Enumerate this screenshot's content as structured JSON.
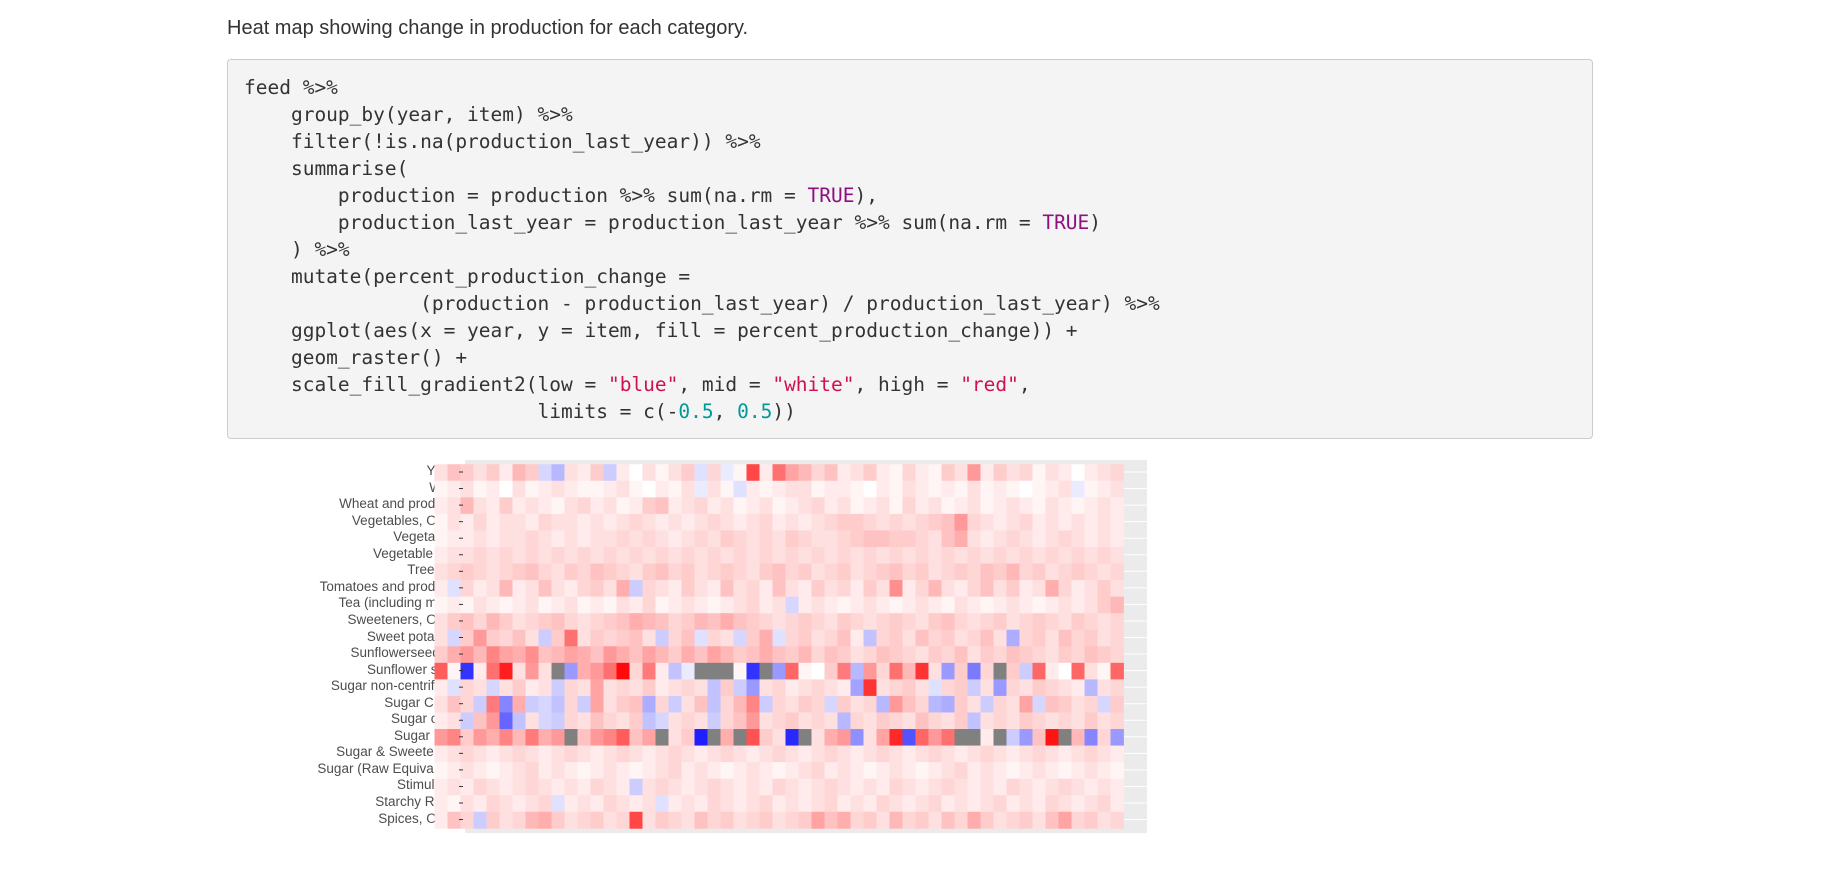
{
  "caption": "Heat map showing change in production for each category.",
  "code": {
    "lines": [
      [
        [
          "feed %>%",
          ""
        ]
      ],
      [
        [
          "    group_by(year, item) %>%",
          ""
        ]
      ],
      [
        [
          "    filter(!is.na(production_last_year)) %>%",
          ""
        ]
      ],
      [
        [
          "    summarise(",
          ""
        ]
      ],
      [
        [
          "        production = production %>% sum(na.rm = ",
          ""
        ],
        [
          "TRUE",
          "kw"
        ],
        [
          "),",
          ""
        ]
      ],
      [
        [
          "        production_last_year = production_last_year %>% sum(na.rm = ",
          ""
        ],
        [
          "TRUE",
          "kw"
        ],
        [
          ")",
          ""
        ]
      ],
      [
        [
          "    ) %>%",
          ""
        ]
      ],
      [
        [
          "    mutate(percent_production_change =",
          ""
        ]
      ],
      [
        [
          "               (production - production_last_year) / production_last_year) %>%",
          ""
        ]
      ],
      [
        [
          "    ggplot(aes(x = year, y = item, fill = percent_production_change)) +",
          ""
        ]
      ],
      [
        [
          "    geom_raster() +",
          ""
        ]
      ],
      [
        [
          "    scale_fill_gradient2(low = ",
          ""
        ],
        [
          "\"blue\"",
          "str"
        ],
        [
          ", mid = ",
          ""
        ],
        [
          "\"white\"",
          "str"
        ],
        [
          ", high = ",
          ""
        ],
        [
          "\"red\"",
          "str"
        ],
        [
          ",",
          ""
        ]
      ],
      [
        [
          "                         limits = c(-",
          ""
        ],
        [
          "0.5",
          "num"
        ],
        [
          ", ",
          ""
        ],
        [
          "0.5",
          "num"
        ],
        [
          "))",
          ""
        ]
      ]
    ]
  },
  "chart_data": {
    "type": "heatmap",
    "x_var": "year",
    "y_var": "item",
    "fill_var": "percent_production_change",
    "fill_scale": {
      "low": "#0000ff",
      "mid": "#ffffff",
      "high": "#ff0000",
      "limits": [
        -0.5,
        0.5
      ],
      "na_color": "#808080"
    },
    "panel_background": "#ebebeb",
    "grid": true,
    "y_categories": [
      "Yams",
      "Wine",
      "Wheat and products",
      "Vegetables, Other",
      "Vegetables",
      "Vegetable Oils",
      "Treenuts",
      "Tomatoes and products",
      "Tea (including mate)",
      "Sweeteners, Other",
      "Sweet potatoes",
      "Sunflowerseed Oil",
      "Sunflower seed",
      "Sugar non-centrifugal",
      "Sugar Crops",
      "Sugar cane",
      "Sugar beet",
      "Sugar & Sweeteners",
      "Sugar (Raw Equivalent)",
      "Stimulants",
      "Starchy Roots",
      "Spices, Other"
    ],
    "rows": [
      [
        0.06,
        0.12,
        0.1,
        0.06,
        0.1,
        0.04,
        0.14,
        0.1,
        -0.08,
        -0.14,
        0.06,
        0.04,
        0.1,
        -0.1,
        0.04,
        0.0,
        0.06,
        0.02,
        0.06,
        0.1,
        -0.06,
        0.08,
        -0.04,
        0.02,
        0.36,
        0.04,
        0.28,
        0.18,
        0.14,
        0.08,
        0.12,
        0.04,
        0.06,
        0.1,
        0.04,
        0.02,
        0.08,
        0.04,
        0.02,
        0.1,
        0.06,
        0.2,
        0.04,
        0.1,
        0.06,
        0.08,
        0.02,
        0.06,
        0.04,
        0.0,
        0.04,
        0.06,
        0.08
      ],
      [
        0.02,
        0.04,
        0.06,
        0.02,
        0.04,
        0.0,
        0.06,
        0.02,
        0.04,
        0.06,
        0.04,
        0.02,
        0.02,
        0.04,
        0.06,
        0.02,
        0.0,
        0.04,
        0.02,
        0.06,
        -0.04,
        0.06,
        0.02,
        -0.06,
        0.04,
        0.02,
        0.04,
        0.06,
        0.06,
        0.02,
        0.04,
        0.04,
        0.02,
        0.0,
        0.04,
        0.02,
        0.06,
        0.04,
        0.02,
        0.04,
        0.02,
        0.06,
        0.02,
        0.04,
        0.02,
        0.0,
        0.02,
        0.04,
        0.06,
        -0.04,
        0.02,
        0.04,
        0.06
      ],
      [
        0.04,
        0.06,
        0.14,
        0.06,
        0.04,
        0.1,
        0.04,
        0.06,
        0.04,
        0.02,
        0.06,
        0.08,
        0.04,
        0.06,
        0.02,
        0.04,
        0.1,
        0.12,
        0.04,
        0.06,
        0.08,
        0.04,
        0.06,
        0.02,
        0.04,
        0.06,
        0.02,
        0.04,
        0.06,
        0.08,
        0.04,
        0.06,
        0.02,
        0.04,
        0.06,
        0.02,
        0.08,
        0.04,
        0.06,
        0.02,
        0.04,
        0.06,
        0.02,
        0.04,
        0.06,
        0.04,
        0.02,
        0.06,
        0.04,
        0.02,
        0.04,
        0.06,
        0.04
      ],
      [
        0.02,
        0.06,
        0.04,
        0.08,
        0.04,
        0.06,
        0.06,
        0.04,
        0.08,
        0.06,
        0.06,
        0.04,
        0.06,
        0.04,
        0.06,
        0.08,
        0.06,
        0.04,
        0.06,
        0.04,
        0.06,
        0.08,
        0.06,
        0.04,
        0.06,
        0.08,
        0.04,
        0.06,
        0.04,
        0.06,
        0.08,
        0.1,
        0.1,
        0.08,
        0.06,
        0.08,
        0.06,
        0.08,
        0.1,
        0.12,
        0.2,
        0.08,
        0.06,
        0.04,
        0.06,
        0.08,
        0.04,
        0.06,
        0.04,
        0.06,
        0.04,
        0.06,
        0.04
      ],
      [
        0.02,
        0.04,
        0.04,
        0.06,
        0.04,
        0.06,
        0.06,
        0.08,
        0.06,
        0.04,
        0.06,
        0.04,
        0.06,
        0.06,
        0.08,
        0.06,
        0.08,
        0.06,
        0.04,
        0.06,
        0.08,
        0.06,
        0.1,
        0.08,
        0.06,
        0.08,
        0.06,
        0.1,
        0.08,
        0.06,
        0.06,
        0.08,
        0.1,
        0.12,
        0.12,
        0.1,
        0.1,
        0.08,
        0.06,
        0.12,
        0.16,
        0.06,
        0.04,
        0.06,
        0.08,
        0.06,
        0.04,
        0.06,
        0.08,
        0.06,
        0.04,
        0.06,
        0.04
      ],
      [
        0.04,
        0.06,
        0.06,
        0.08,
        0.06,
        0.08,
        0.06,
        0.08,
        0.06,
        0.08,
        0.06,
        0.08,
        0.06,
        0.08,
        0.06,
        0.08,
        0.06,
        0.08,
        0.06,
        0.08,
        0.06,
        0.08,
        0.06,
        0.08,
        0.06,
        0.08,
        0.06,
        0.08,
        0.06,
        0.08,
        0.06,
        0.08,
        0.06,
        0.08,
        0.06,
        0.08,
        0.06,
        0.08,
        0.06,
        0.08,
        0.06,
        0.08,
        0.06,
        0.08,
        0.06,
        0.08,
        0.06,
        0.08,
        0.06,
        0.08,
        0.06,
        0.08,
        0.06
      ],
      [
        0.06,
        0.08,
        0.1,
        0.08,
        0.06,
        0.08,
        0.1,
        0.12,
        0.08,
        0.06,
        0.1,
        0.08,
        0.12,
        0.1,
        0.08,
        0.06,
        0.1,
        0.12,
        0.08,
        0.1,
        0.06,
        0.08,
        0.1,
        0.08,
        0.06,
        0.1,
        0.12,
        0.08,
        0.1,
        0.06,
        0.08,
        0.1,
        0.06,
        0.08,
        0.1,
        0.12,
        0.08,
        0.1,
        0.06,
        0.08,
        0.1,
        0.08,
        0.12,
        0.1,
        0.14,
        0.08,
        0.1,
        0.06,
        0.08,
        0.1,
        0.08,
        0.06,
        0.08
      ],
      [
        0.04,
        -0.06,
        0.08,
        0.04,
        0.06,
        0.14,
        0.04,
        0.06,
        0.12,
        0.06,
        0.04,
        0.08,
        0.1,
        0.06,
        0.16,
        -0.1,
        0.08,
        0.06,
        0.04,
        0.1,
        0.06,
        0.04,
        0.12,
        0.06,
        0.08,
        0.04,
        0.12,
        0.06,
        0.04,
        0.1,
        0.06,
        0.08,
        0.04,
        0.1,
        0.06,
        0.22,
        0.04,
        0.08,
        0.14,
        0.06,
        0.04,
        0.08,
        0.12,
        0.06,
        0.1,
        0.04,
        0.06,
        0.16,
        0.08,
        0.04,
        0.06,
        0.1,
        0.06
      ],
      [
        0.02,
        0.04,
        0.02,
        0.06,
        0.04,
        0.02,
        0.04,
        0.06,
        0.02,
        0.04,
        0.06,
        0.02,
        0.04,
        0.02,
        0.06,
        0.04,
        0.08,
        0.02,
        0.04,
        0.06,
        0.04,
        0.02,
        0.04,
        0.06,
        0.08,
        0.04,
        0.06,
        -0.08,
        0.04,
        0.06,
        0.04,
        0.02,
        0.04,
        0.06,
        0.04,
        0.02,
        0.04,
        0.06,
        0.04,
        0.02,
        0.06,
        0.04,
        0.02,
        0.04,
        0.06,
        0.04,
        0.02,
        0.04,
        0.06,
        0.04,
        0.06,
        0.1,
        0.14
      ],
      [
        0.06,
        0.1,
        0.12,
        0.08,
        0.14,
        0.1,
        0.06,
        0.08,
        0.1,
        0.12,
        0.08,
        0.06,
        0.08,
        0.1,
        0.12,
        0.16,
        0.14,
        0.12,
        0.08,
        0.1,
        0.14,
        0.12,
        0.16,
        0.12,
        0.1,
        0.08,
        0.06,
        0.08,
        0.1,
        0.08,
        0.06,
        0.1,
        0.08,
        0.06,
        0.08,
        0.1,
        0.08,
        0.06,
        0.1,
        0.12,
        0.08,
        0.06,
        0.08,
        0.1,
        0.06,
        0.08,
        0.1,
        0.08,
        0.06,
        0.1,
        0.08,
        0.06,
        0.08
      ],
      [
        0.06,
        -0.08,
        0.1,
        0.2,
        0.1,
        0.08,
        0.12,
        0.06,
        -0.1,
        0.1,
        0.28,
        0.06,
        0.1,
        0.08,
        0.1,
        0.12,
        0.06,
        -0.1,
        0.08,
        0.12,
        -0.06,
        0.08,
        0.06,
        -0.08,
        0.1,
        0.16,
        -0.06,
        0.08,
        0.1,
        0.06,
        0.08,
        0.12,
        0.04,
        -0.12,
        0.08,
        0.1,
        0.06,
        0.12,
        0.08,
        0.1,
        0.06,
        0.08,
        0.12,
        0.06,
        -0.16,
        0.08,
        0.1,
        0.06,
        0.12,
        0.08,
        0.1,
        0.06,
        0.08
      ],
      [
        0.1,
        0.16,
        0.2,
        0.14,
        0.24,
        0.18,
        0.16,
        0.22,
        0.12,
        0.14,
        0.18,
        0.16,
        0.12,
        0.2,
        0.16,
        0.12,
        0.18,
        0.14,
        0.1,
        0.16,
        0.12,
        0.18,
        0.14,
        0.1,
        0.12,
        0.16,
        0.12,
        0.1,
        0.14,
        0.08,
        0.12,
        0.1,
        0.06,
        0.08,
        0.12,
        0.1,
        0.08,
        0.06,
        0.1,
        0.08,
        0.12,
        0.06,
        0.1,
        0.08,
        0.12,
        0.1,
        0.08,
        0.06,
        0.1,
        0.08,
        0.12,
        0.1,
        0.08
      ],
      [
        0.32,
        0.02,
        -0.4,
        0.04,
        0.28,
        0.44,
        0.06,
        0.2,
        0.06,
        null,
        -0.2,
        0.16,
        0.2,
        0.28,
        0.48,
        0.08,
        0.26,
        0.04,
        -0.12,
        -0.04,
        null,
        null,
        null,
        0.02,
        -0.4,
        null,
        -0.2,
        0.3,
        0.02,
        0.0,
        0.1,
        0.26,
        -0.14,
        0.2,
        0.08,
        0.28,
        0.14,
        0.4,
        0.06,
        -0.2,
        0.1,
        -0.26,
        0.08,
        null,
        0.1,
        -0.1,
        0.3,
        0.04,
        0.0,
        0.3,
        0.06,
        0.02,
        0.3
      ],
      [
        0.04,
        -0.06,
        0.08,
        0.06,
        -0.08,
        0.06,
        0.1,
        0.04,
        0.06,
        -0.1,
        0.08,
        0.06,
        0.18,
        0.06,
        0.08,
        0.06,
        0.1,
        0.04,
        0.06,
        0.08,
        0.06,
        -0.12,
        0.1,
        -0.1,
        -0.2,
        0.06,
        0.08,
        0.04,
        0.06,
        0.08,
        0.06,
        0.04,
        -0.18,
        0.4,
        0.06,
        0.08,
        0.1,
        0.06,
        -0.06,
        0.08,
        0.1,
        -0.1,
        0.06,
        -0.2,
        0.08,
        0.06,
        0.1,
        0.08,
        0.06,
        0.04,
        -0.14,
        0.06,
        0.08
      ],
      [
        0.06,
        0.12,
        0.08,
        -0.1,
        0.26,
        -0.24,
        0.16,
        -0.1,
        -0.08,
        -0.12,
        0.08,
        -0.1,
        0.18,
        0.06,
        0.1,
        0.12,
        -0.16,
        0.08,
        -0.1,
        0.06,
        0.12,
        -0.12,
        0.08,
        0.14,
        0.24,
        -0.1,
        0.08,
        0.06,
        0.1,
        0.08,
        -0.08,
        0.1,
        0.06,
        0.08,
        -0.14,
        0.2,
        0.12,
        0.08,
        -0.14,
        -0.16,
        0.1,
        0.06,
        -0.1,
        0.08,
        0.06,
        0.18,
        -0.08,
        0.12,
        0.1,
        0.06,
        0.08,
        -0.08,
        0.1
      ],
      [
        0.04,
        0.06,
        -0.1,
        0.12,
        0.2,
        -0.3,
        -0.12,
        0.06,
        -0.08,
        -0.1,
        0.08,
        0.06,
        0.12,
        0.08,
        0.06,
        0.1,
        -0.12,
        -0.08,
        0.06,
        0.08,
        0.06,
        -0.1,
        0.08,
        0.12,
        0.2,
        0.06,
        0.08,
        0.1,
        0.06,
        0.08,
        0.06,
        -0.14,
        0.08,
        0.06,
        0.1,
        0.08,
        0.06,
        0.12,
        0.08,
        0.06,
        0.1,
        -0.12,
        0.06,
        0.08,
        0.06,
        0.1,
        0.08,
        0.06,
        0.08,
        0.06,
        0.1,
        0.06,
        0.08
      ],
      [
        0.2,
        0.24,
        0.1,
        0.2,
        0.16,
        0.24,
        0.14,
        0.26,
        0.16,
        0.2,
        null,
        0.12,
        0.2,
        0.24,
        0.32,
        0.12,
        0.18,
        null,
        0.06,
        0.1,
        -0.44,
        null,
        0.16,
        null,
        0.34,
        0.1,
        0.06,
        -0.42,
        null,
        0.06,
        0.16,
        0.2,
        -0.22,
        0.06,
        0.18,
        0.42,
        -0.34,
        0.3,
        0.2,
        0.28,
        null,
        null,
        0.04,
        null,
        -0.1,
        -0.2,
        0.12,
        0.46,
        null,
        0.14,
        -0.24,
        0.08,
        -0.2
      ],
      [
        0.04,
        0.06,
        0.08,
        0.06,
        0.04,
        0.06,
        0.08,
        0.06,
        0.04,
        0.06,
        0.08,
        0.06,
        0.04,
        0.06,
        0.08,
        0.06,
        0.04,
        0.06,
        0.08,
        0.06,
        0.04,
        0.06,
        0.08,
        0.06,
        0.04,
        0.06,
        0.08,
        0.06,
        0.04,
        0.06,
        0.08,
        0.06,
        0.04,
        0.06,
        0.08,
        0.06,
        0.04,
        0.06,
        0.08,
        0.06,
        0.04,
        0.06,
        0.08,
        0.06,
        0.04,
        0.06,
        0.08,
        0.06,
        0.04,
        0.06,
        0.08,
        0.06,
        0.04
      ],
      [
        0.02,
        0.04,
        0.06,
        0.04,
        0.02,
        0.04,
        0.06,
        0.08,
        0.04,
        0.06,
        0.04,
        0.02,
        0.04,
        0.06,
        0.04,
        0.02,
        0.04,
        0.06,
        0.08,
        0.04,
        0.06,
        0.04,
        0.02,
        0.04,
        0.06,
        0.04,
        0.02,
        0.04,
        0.06,
        0.08,
        0.04,
        0.06,
        0.04,
        0.02,
        0.04,
        0.06,
        0.04,
        0.02,
        0.04,
        0.06,
        0.08,
        0.04,
        0.06,
        0.04,
        0.02,
        0.04,
        0.06,
        0.04,
        0.02,
        0.04,
        0.06,
        0.04,
        0.02
      ],
      [
        0.04,
        0.06,
        0.04,
        0.08,
        0.06,
        0.04,
        0.06,
        0.08,
        0.06,
        0.04,
        0.06,
        0.04,
        0.08,
        0.06,
        0.04,
        -0.1,
        0.06,
        0.08,
        0.06,
        0.04,
        0.06,
        0.08,
        0.06,
        0.04,
        0.06,
        0.04,
        0.08,
        0.06,
        0.04,
        0.06,
        0.08,
        0.06,
        0.04,
        0.06,
        0.04,
        0.08,
        0.06,
        0.04,
        0.06,
        0.08,
        0.06,
        0.04,
        0.06,
        0.04,
        0.08,
        0.06,
        0.04,
        0.06,
        0.08,
        0.06,
        0.04,
        0.06,
        0.04
      ],
      [
        0.04,
        0.02,
        0.06,
        0.04,
        0.08,
        0.06,
        0.04,
        0.06,
        0.08,
        -0.06,
        0.04,
        0.06,
        0.04,
        0.08,
        0.06,
        0.04,
        0.06,
        -0.06,
        0.04,
        0.06,
        0.04,
        0.08,
        0.06,
        0.04,
        0.06,
        0.08,
        0.04,
        0.06,
        0.04,
        0.06,
        0.08,
        0.04,
        0.06,
        0.04,
        0.08,
        0.06,
        0.04,
        0.06,
        0.08,
        0.04,
        0.06,
        0.04,
        0.06,
        0.08,
        0.04,
        0.06,
        0.04,
        0.08,
        0.06,
        0.04,
        0.06,
        0.08,
        0.04
      ],
      [
        0.04,
        0.12,
        0.08,
        -0.1,
        0.1,
        0.06,
        0.08,
        0.14,
        0.16,
        0.1,
        0.06,
        0.08,
        0.1,
        0.06,
        0.08,
        0.36,
        0.06,
        0.1,
        0.08,
        0.06,
        0.12,
        0.08,
        0.1,
        0.06,
        0.08,
        0.1,
        0.06,
        0.08,
        0.1,
        0.18,
        0.12,
        0.16,
        0.08,
        0.1,
        0.06,
        0.14,
        0.08,
        0.1,
        0.06,
        0.12,
        0.08,
        0.16,
        0.1,
        0.06,
        0.08,
        0.1,
        0.06,
        0.12,
        0.18,
        0.08,
        0.1,
        0.06,
        0.08
      ]
    ]
  }
}
